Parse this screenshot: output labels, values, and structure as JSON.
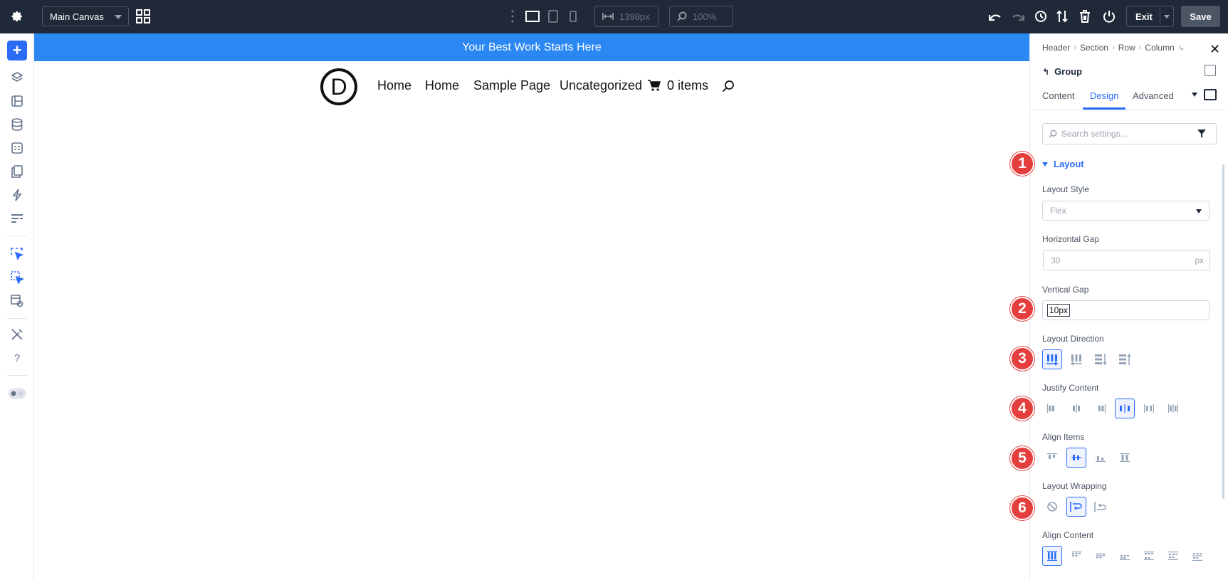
{
  "topbar": {
    "canvas_select": "Main Canvas",
    "width_value": "1398px",
    "zoom_value": "100%",
    "exit_label": "Exit",
    "save_label": "Save"
  },
  "canvas": {
    "banner_text": "Your Best Work Starts Here",
    "logo_letter": "D",
    "nav_items": [
      "Home",
      "Home",
      "Sample Page",
      "Uncategorized"
    ],
    "cart_text": "0 items"
  },
  "panel": {
    "breadcrumbs": [
      "Header",
      "Section",
      "Row",
      "Column"
    ],
    "group_label": "Group",
    "tabs": [
      "Content",
      "Design",
      "Advanced"
    ],
    "search_placeholder": "Search settings...",
    "section_title": "Layout",
    "layout_style_label": "Layout Style",
    "layout_style_value": "Flex",
    "horizontal_gap_label": "Horizontal Gap",
    "horizontal_gap_value": "30",
    "horizontal_gap_unit": "px",
    "vertical_gap_label": "Vertical Gap",
    "vertical_gap_value": "10px",
    "layout_direction_label": "Layout Direction",
    "justify_content_label": "Justify Content",
    "align_items_label": "Align Items",
    "layout_wrapping_label": "Layout Wrapping",
    "align_content_label": "Align Content"
  },
  "badges": [
    "1",
    "2",
    "3",
    "4",
    "5",
    "6"
  ],
  "colors": {
    "accent": "#2b6cf6",
    "banner": "#2b87f2",
    "topbar": "#1f2937",
    "badge": "#e53e3e"
  }
}
